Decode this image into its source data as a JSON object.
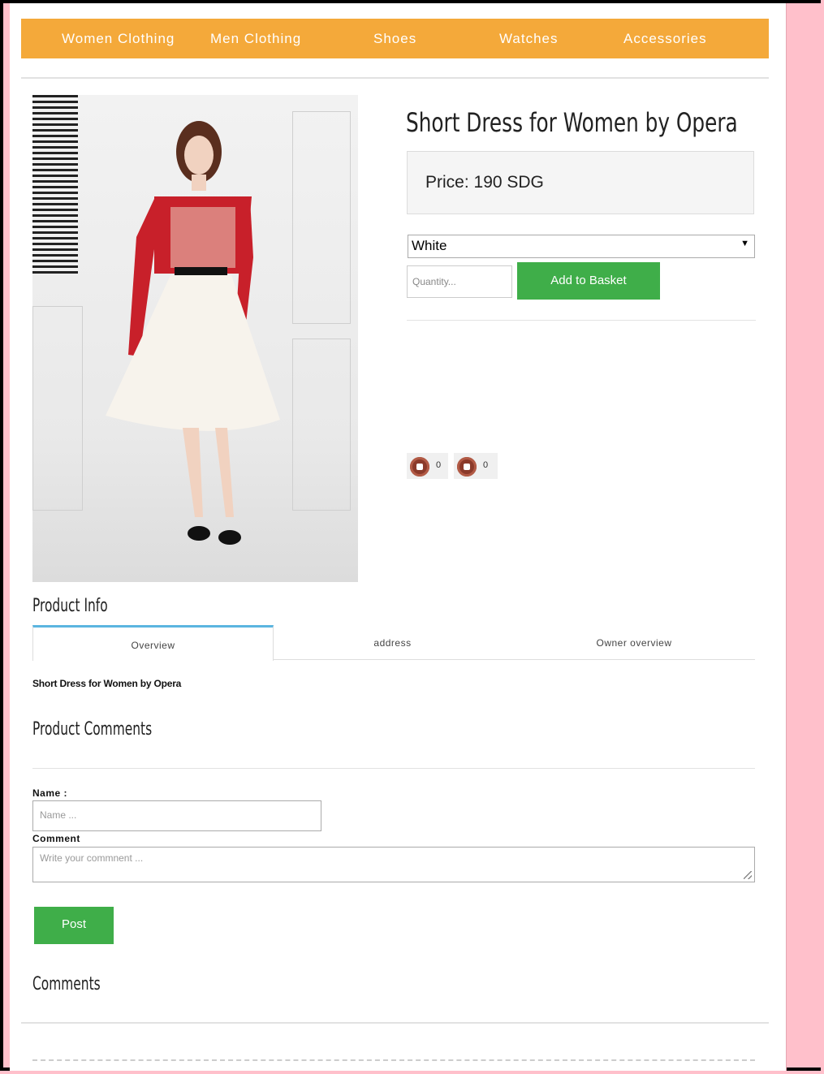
{
  "nav": {
    "items": [
      {
        "label": "Women Clothing"
      },
      {
        "label": "Men Clothing"
      },
      {
        "label": "Shoes"
      },
      {
        "label": "Watches"
      },
      {
        "label": "Accessories"
      }
    ],
    "color": "#f4a93a"
  },
  "product": {
    "title": "Short Dress for Women by Opera",
    "price": "Price: 190 SDG",
    "color_select": "White",
    "quantity_placeholder": "Quantity...",
    "add_button": "Add to Basket",
    "likes": "0",
    "dislikes": "0"
  },
  "info": {
    "heading": "Product Info",
    "tabs": [
      {
        "label": "Overview"
      },
      {
        "label": "address"
      },
      {
        "label": "Owner overview"
      }
    ],
    "description": "Short Dress for Women by Opera"
  },
  "comments_form": {
    "heading": "Product Comments",
    "name_label": "Name :",
    "name_placeholder": "Name ...",
    "comment_label": "Comment",
    "comment_placeholder": "Write your commnent ...",
    "post_button": "Post"
  },
  "comments": {
    "heading": "Comments"
  },
  "colors": {
    "accent": "#f4a93a",
    "button": "#3fae49",
    "background": "#ffc0cb"
  }
}
